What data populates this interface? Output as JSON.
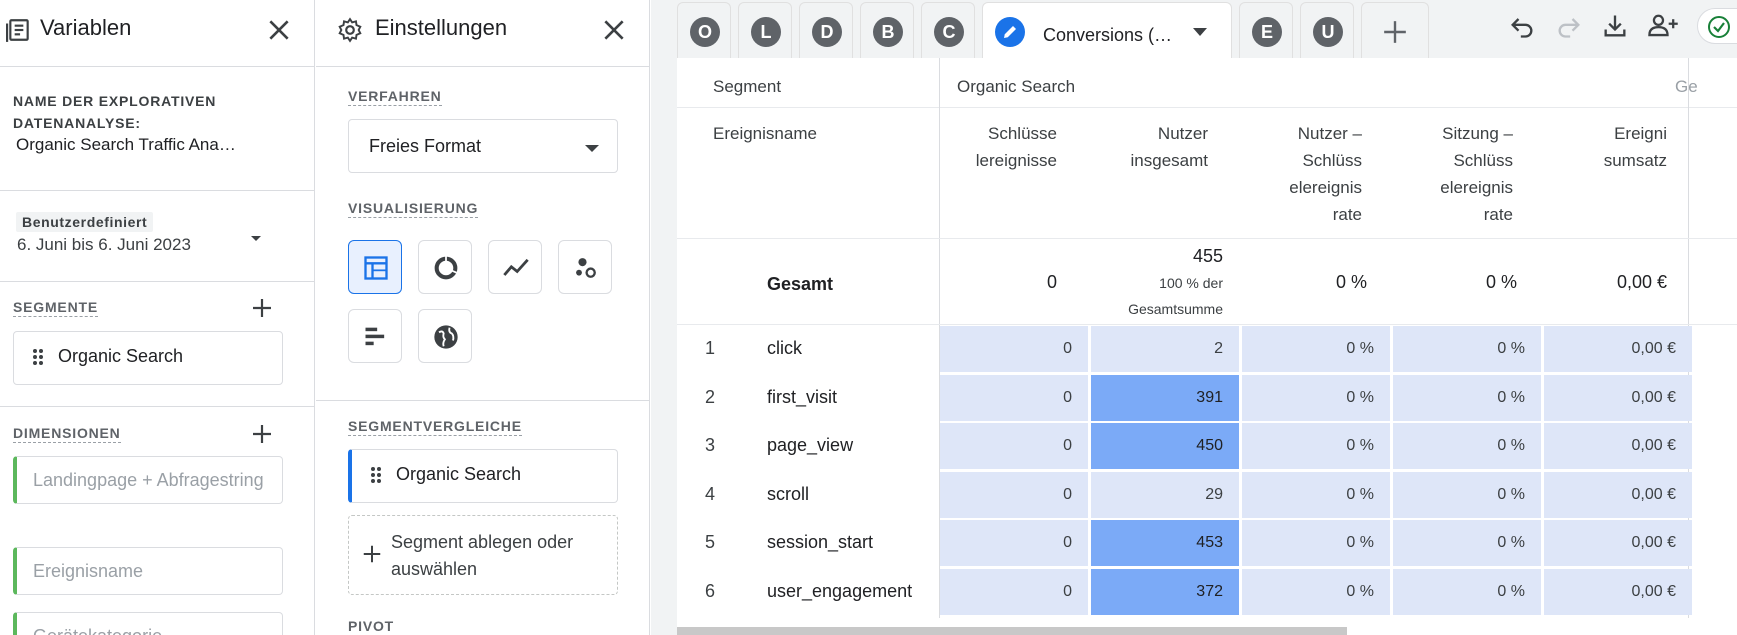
{
  "variables": {
    "title": "Variablen",
    "name_label": "NAME DER EXPLORATIVEN DATENANALYSE:",
    "name_value": "Organic Search Traffic Ana…",
    "date_chip": "Benutzerdefiniert",
    "date_range": "6. Juni bis 6. Juni 2023",
    "segments_label": "SEGMENTE",
    "segment_item": "Organic Search",
    "dimensions_label": "DIMENSIONEN",
    "dimension_items": [
      "Landingpage + Abfragestring",
      "Ereignisname",
      "Gerätekategorie"
    ]
  },
  "settings": {
    "title": "Einstellungen",
    "technique_label": "VERFAHREN",
    "technique_value": "Freies Format",
    "viz_label": "VISUALISIERUNG",
    "viz_options": [
      "table-icon",
      "donut-chart-icon",
      "line-chart-icon",
      "scatter-icon",
      "bar-chart-icon",
      "globe-icon"
    ],
    "segment_compare_label": "SEGMENTVERGLEICHE",
    "segment_compare_item": "Organic Search",
    "drop_segment_text": "Segment ablegen oder auswählen",
    "pivot_label": "PIVOT"
  },
  "tabs": {
    "letters": [
      "O",
      "L",
      "D",
      "B",
      "C"
    ],
    "active_title": "Conversions (…",
    "after_letters": [
      "E",
      "U"
    ]
  },
  "table": {
    "segment_header": "Segment",
    "segment_value": "Organic Search",
    "next_segment_fragment": "Ge",
    "row_dimension_header": "Ereignisname",
    "columns": [
      "Schlüsse lereignisse",
      "Nutzer insgesamt",
      "Nutzer – Schlüss elereignis rate",
      "Sitzung – Schlüss elereignis rate",
      "Ereigni sumsatz"
    ],
    "total": {
      "label": "Gesamt",
      "values": [
        "0",
        "455",
        "0 %",
        "0 %",
        "0,00 €"
      ],
      "users_sub": "100 % der Gesamtsumme"
    },
    "rows": [
      {
        "num": "1",
        "name": "click",
        "values": [
          "0",
          "2",
          "0 %",
          "0 %",
          "0,00 €"
        ]
      },
      {
        "num": "2",
        "name": "first_visit",
        "values": [
          "0",
          "391",
          "0 %",
          "0 %",
          "0,00 €"
        ]
      },
      {
        "num": "3",
        "name": "page_view",
        "values": [
          "0",
          "450",
          "0 %",
          "0 %",
          "0,00 €"
        ]
      },
      {
        "num": "4",
        "name": "scroll",
        "values": [
          "0",
          "29",
          "0 %",
          "0 %",
          "0,00 €"
        ]
      },
      {
        "num": "5",
        "name": "session_start",
        "values": [
          "0",
          "453",
          "0 %",
          "0 %",
          "0,00 €"
        ]
      },
      {
        "num": "6",
        "name": "user_engagement",
        "values": [
          "0",
          "372",
          "0 %",
          "0 %",
          "0,00 €"
        ]
      }
    ]
  },
  "colors": {
    "accent": "#1a73e8",
    "cell_light": "#dee6f8",
    "cell_heat": "#7baaf7",
    "dimension_bar": "#5cb85c",
    "status_green": "#188038"
  }
}
